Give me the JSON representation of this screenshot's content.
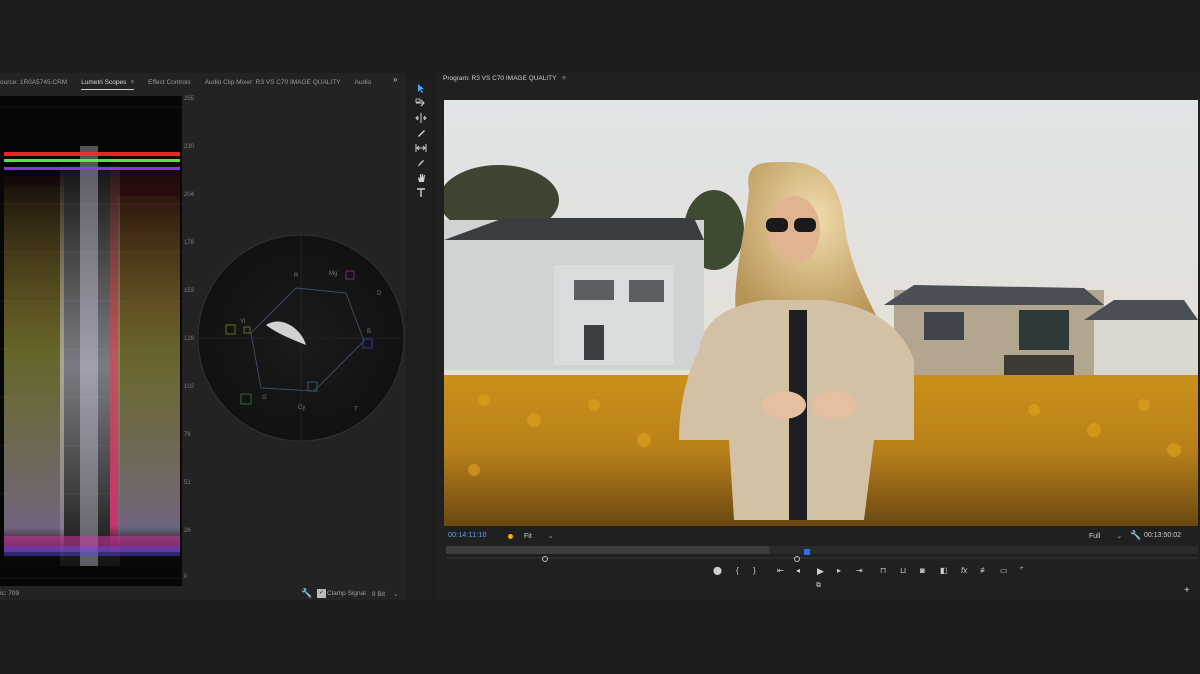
{
  "scopes_panel": {
    "tabs": [
      {
        "label": "ource: 1R0A5745.CRM",
        "active": false
      },
      {
        "label": "Lumetri Scopes",
        "active": true
      },
      {
        "label": "Effect Controls",
        "active": false
      },
      {
        "label": "Audio Clip Mixer: R3 VS C70 IMAGE QUALITY",
        "active": false
      },
      {
        "label": "Audio",
        "active": false
      }
    ],
    "overflow_label": "»",
    "waveform_scale_right": [
      "255",
      "230",
      "204",
      "178",
      "153",
      "128",
      "102",
      "76",
      "51",
      "26",
      "0"
    ],
    "vectorscope_targets": [
      "R",
      "Mg",
      "B",
      "Cy",
      "G",
      "Yl",
      "D",
      "T"
    ],
    "footer": {
      "left_text": "ic: 709",
      "clamp_signal_label": "Clamp Signal",
      "clamp_signal_checked": true,
      "bit_depth": "8 Bit"
    }
  },
  "tools": [
    "selection-tool",
    "track-select-tool",
    "ripple-edit-tool",
    "razor-tool",
    "slip-tool",
    "pen-tool",
    "hand-tool",
    "type-tool"
  ],
  "program_monitor": {
    "title": "Program: R3 VS C70 IMAGE QUALITY",
    "menu_glyph": "≡",
    "current_time": "00:14:11:10",
    "fit_label": "Fit",
    "quality_label": "Full",
    "duration": "00:13:50:02",
    "playhead_fraction": 0.48,
    "in_out_fill_fraction": 0.43
  },
  "colors": {
    "accent_blue": "#5aa7ff",
    "marker_yellow": "#f1b400",
    "panel_bg": "#232323"
  }
}
